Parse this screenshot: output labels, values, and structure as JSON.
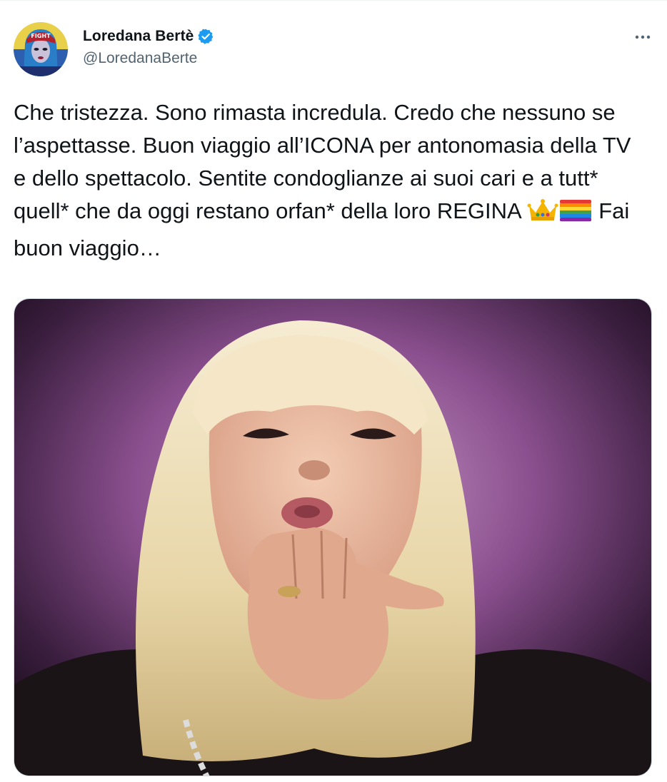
{
  "tweet": {
    "author": {
      "display_name": "Loredana Bertè",
      "handle": "@LoredanaBerte",
      "verified": true,
      "avatar_icon": "avatar-image"
    },
    "more_icon": "more-dots-icon",
    "text_before_emoji": "Che tristezza. Sono rimasta incredula. Credo che nessuno se l’aspettasse. Buon viaggio all’ICONA per antonomasia della TV e dello spettacolo. Sentite condoglianze ai suoi cari e a tutt* quell* che da oggi restano orfan* della loro REGINA ",
    "emojis": [
      "crown-emoji",
      "rainbow-flag-emoji"
    ],
    "text_after_emoji": " Fai buon viaggio…",
    "media": {
      "type": "photo",
      "icon": "photo-image"
    }
  },
  "colors": {
    "text": "#0f1419",
    "secondary": "#536471",
    "verified": "#1d9bf0",
    "border": "#cfd9de"
  }
}
